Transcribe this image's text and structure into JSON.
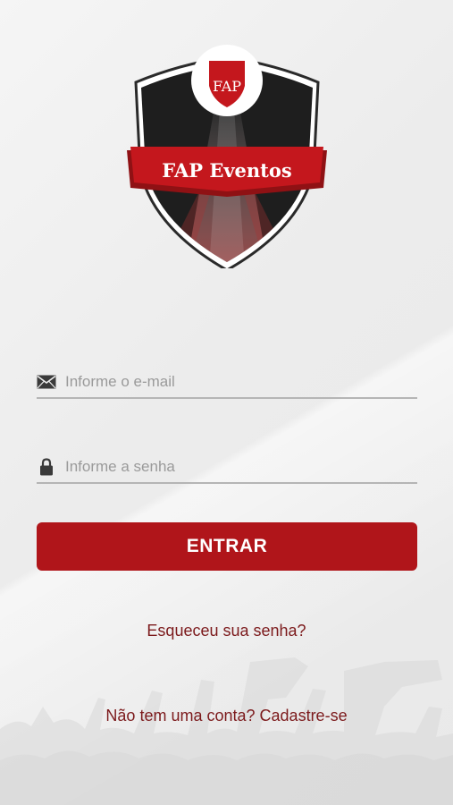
{
  "logo": {
    "monogram": "FAP",
    "title": "FAP Eventos"
  },
  "email": {
    "placeholder": "Informe o e-mail",
    "value": ""
  },
  "password": {
    "placeholder": "Informe a senha",
    "value": ""
  },
  "login_button": "ENTRAR",
  "forgot_link": "Esqueceu sua senha?",
  "signup": {
    "prompt": "Não tem uma conta?",
    "link": "Cadastre-se"
  },
  "colors": {
    "brand_red": "#b0151a",
    "link_red": "#7c1a1c"
  },
  "icons": [
    "envelope-icon",
    "lock-icon"
  ]
}
